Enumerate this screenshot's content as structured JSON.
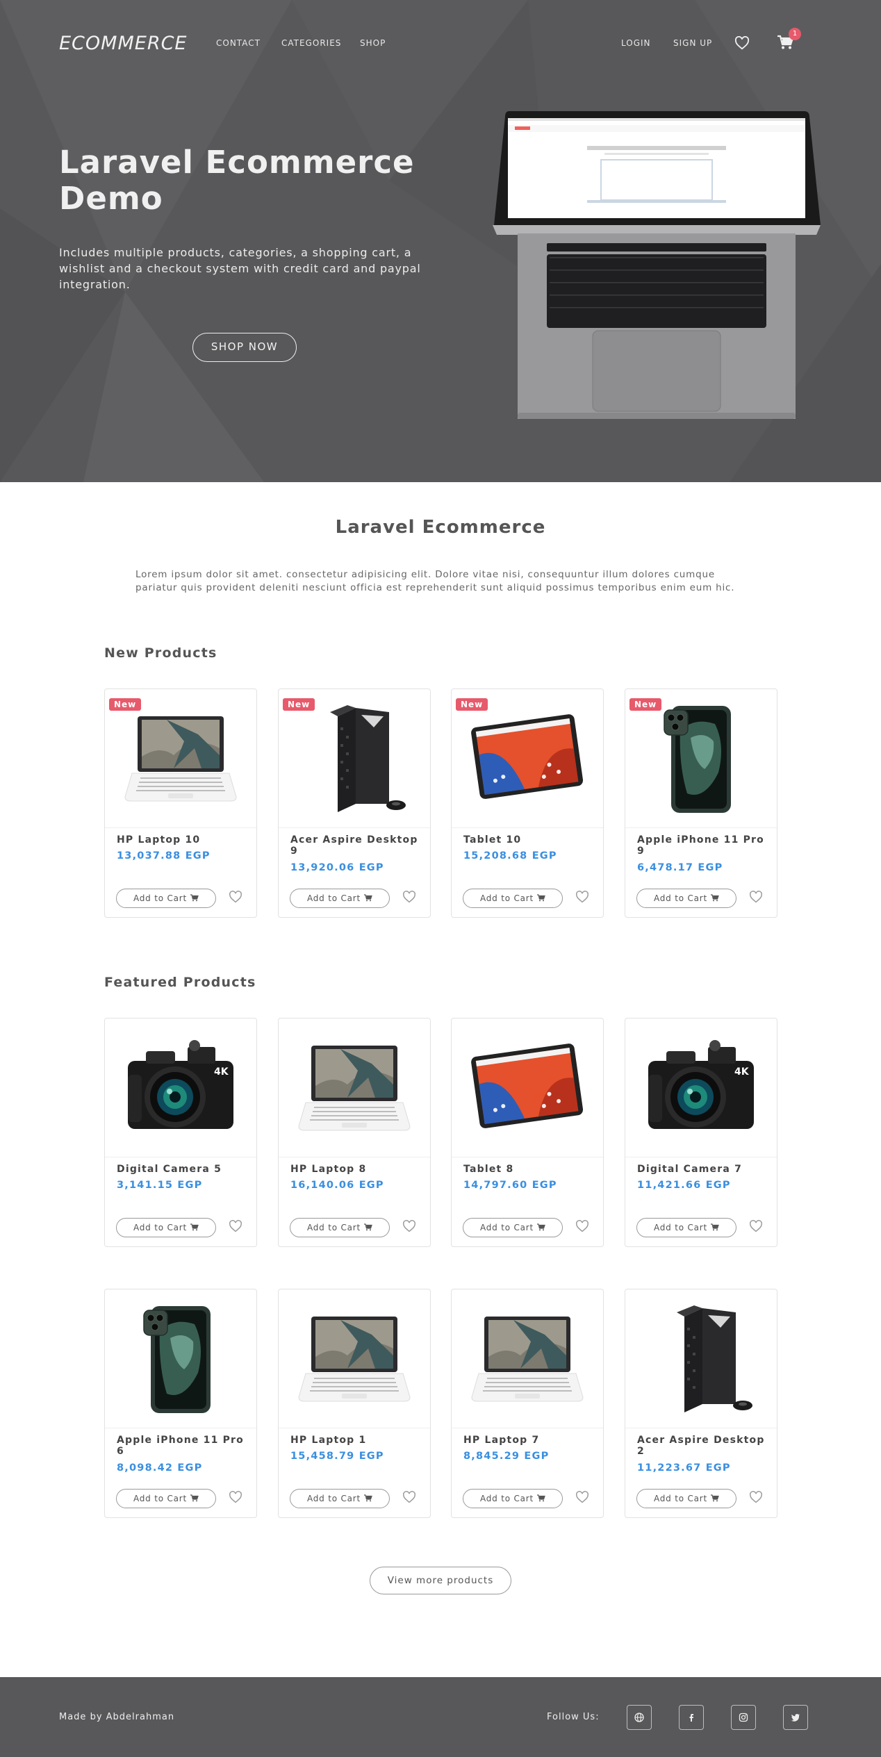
{
  "nav": {
    "brand": "ECOMMERCE",
    "links": [
      "CONTACT",
      "CATEGORIES",
      "SHOP"
    ],
    "login": "LOGIN",
    "signup": "SIGN UP",
    "cart_count": "1"
  },
  "hero": {
    "title": "Laravel Ecommerce Demo",
    "text": "Includes multiple products, categories, a shopping cart, a wishlist and a checkout system with credit card and paypal integration.",
    "button": "SHOP NOW"
  },
  "intro": {
    "title": "Laravel Ecommerce",
    "text": "Lorem ipsum dolor sit amet. consectetur adipisicing elit. Dolore vitae nisi, consequuntur illum dolores cumque pariatur quis provident deleniti nesciunt officia est reprehenderit sunt aliquid possimus temporibus enim eum hic."
  },
  "new_products": {
    "title": "New Products",
    "badge": "New",
    "items": [
      {
        "name": "HP Laptop 10",
        "price": "13,037.88 EGP",
        "image": "laptop"
      },
      {
        "name": "Acer Aspire Desktop 9",
        "price": "13,920.06 EGP",
        "image": "desktop"
      },
      {
        "name": "Tablet 10",
        "price": "15,208.68 EGP",
        "image": "tablet"
      },
      {
        "name": "Apple iPhone 11 Pro 9",
        "price": "6,478.17 EGP",
        "image": "phone"
      }
    ]
  },
  "featured_products": {
    "title": "Featured Products",
    "items": [
      {
        "name": "Digital Camera 5",
        "price": "3,141.15 EGP",
        "image": "camera"
      },
      {
        "name": "HP Laptop 8",
        "price": "16,140.06 EGP",
        "image": "laptop"
      },
      {
        "name": "Tablet 8",
        "price": "14,797.60 EGP",
        "image": "tablet"
      },
      {
        "name": "Digital Camera 7",
        "price": "11,421.66 EGP",
        "image": "camera"
      },
      {
        "name": "Apple iPhone 11 Pro 6",
        "price": "8,098.42 EGP",
        "image": "phone"
      },
      {
        "name": "HP Laptop 1",
        "price": "15,458.79 EGP",
        "image": "laptop"
      },
      {
        "name": "HP Laptop 7",
        "price": "8,845.29 EGP",
        "image": "laptop"
      },
      {
        "name": "Acer Aspire Desktop 2",
        "price": "11,223.67 EGP",
        "image": "desktop"
      }
    ]
  },
  "card": {
    "add_to_cart": "Add to Cart"
  },
  "view_more": "View more products",
  "footer": {
    "credit": "Made by Abdelrahman",
    "follow": "Follow Us:",
    "social": [
      "globe-icon",
      "facebook-icon",
      "instagram-icon",
      "twitter-icon"
    ]
  },
  "colors": {
    "hero_bg": "#58585a",
    "price": "#3a8fe0",
    "badge": "#e75a6b",
    "footer_bg": "#58585a"
  }
}
